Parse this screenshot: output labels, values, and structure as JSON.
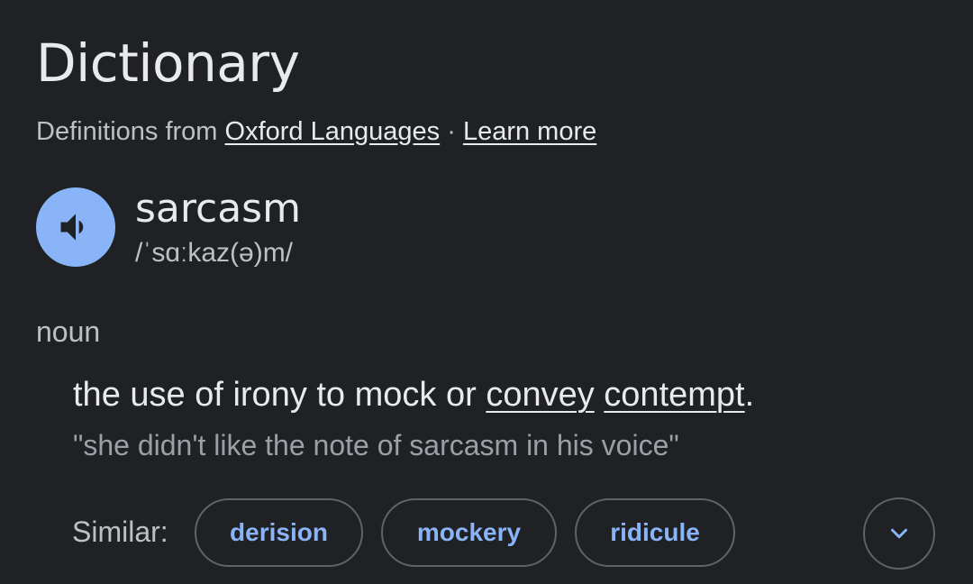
{
  "header": {
    "title": "Dictionary"
  },
  "source": {
    "prefix": "Definitions from",
    "link_text": "Oxford Languages",
    "separator": "·",
    "learn_more": "Learn more"
  },
  "entry": {
    "word": "sarcasm",
    "phonetic": "/ˈsɑːkaz(ə)m/",
    "part_of_speech": "noun",
    "definition": {
      "text_before": "the use of irony to mock or",
      "link_1": "convey",
      "link_2": "contempt",
      "end": "."
    },
    "example": "\"she didn't like the note of sarcasm in his voice\""
  },
  "similar": {
    "label": "Similar:",
    "words": [
      "derision",
      "mockery",
      "ridicule"
    ]
  },
  "icons": {
    "speaker": "volume-up-icon",
    "expand": "chevron-down-icon"
  },
  "colors": {
    "background": "#202124",
    "accent": "#8ab4f8",
    "text_primary": "#e8eaed",
    "text_secondary": "#bdc1c6",
    "text_muted": "#9aa0a6",
    "outline": "#5f6368"
  }
}
